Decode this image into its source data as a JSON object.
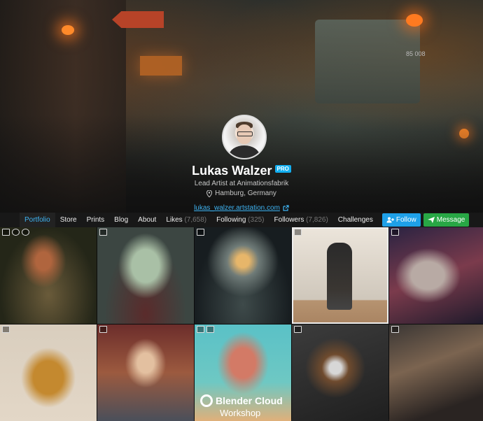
{
  "profile": {
    "name": "Lukas Walzer",
    "badge": "PRO",
    "title": "Lead Artist at Animationsfabrik",
    "location": "Hamburg, Germany",
    "url": "lukas_walzer.artstation.com"
  },
  "banner": {
    "train_number": "85 008"
  },
  "nav": {
    "portfolio": "Portfolio",
    "store": "Store",
    "prints": "Prints",
    "blog": "Blog",
    "about": "About",
    "likes": "Likes",
    "likes_count": "(7,658)",
    "following": "Following",
    "following_count": "(325)",
    "followers": "Followers",
    "followers_count": "(7,826)",
    "challenges": "Challenges",
    "follow_button": "Follow",
    "message_button": "Message"
  },
  "grid": {
    "tile8_line1": "Blender Cloud",
    "tile8_line2": "Workshop"
  },
  "colors": {
    "accent": "#13aff0",
    "follow": "#1ea0e8",
    "message": "#28a745",
    "active_nav": "#3fb4f3"
  },
  "icons": [
    "image-icon",
    "video-icon",
    "3d-icon",
    "pin-icon",
    "external-link-icon",
    "user-plus-icon",
    "paper-plane-icon"
  ]
}
